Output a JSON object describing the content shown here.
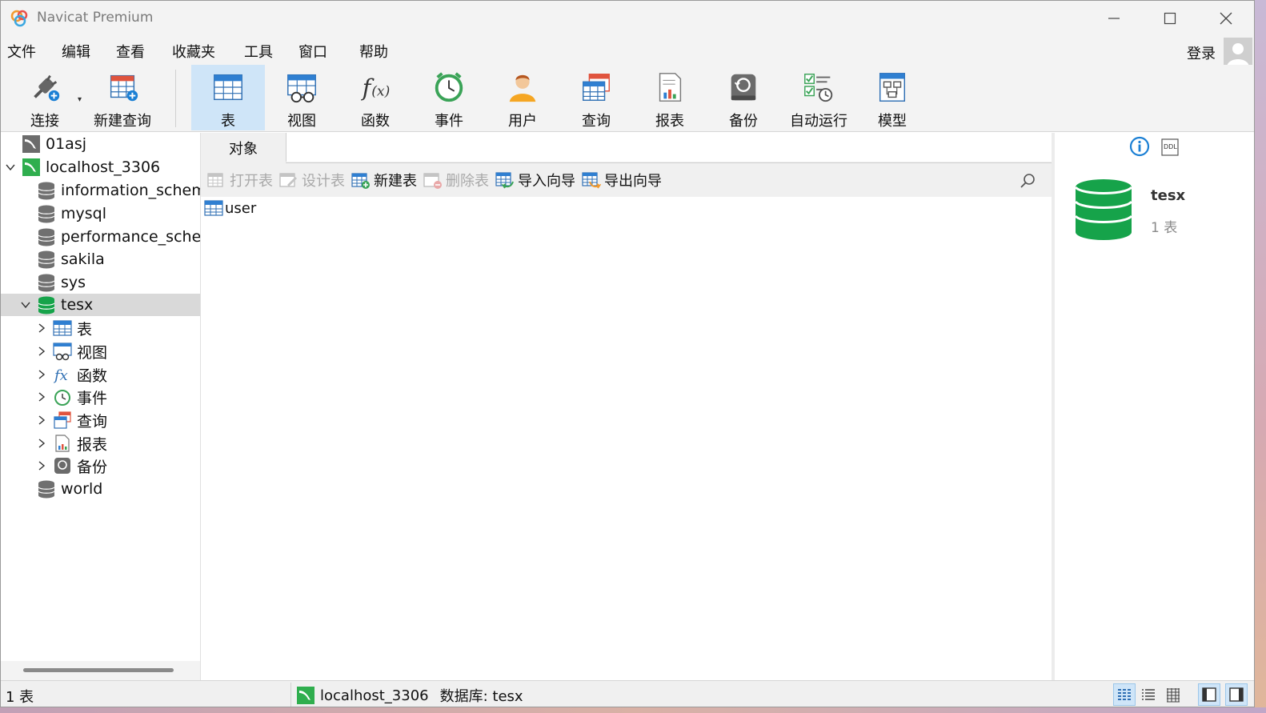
{
  "app": {
    "title": "Navicat Premium",
    "colors": {
      "accent": "#1a7fd4",
      "selection": "#cfe5f8",
      "db_green": "#16a34a"
    }
  },
  "menu": [
    "文件",
    "编辑",
    "查看",
    "收藏夹",
    "工具",
    "窗口",
    "帮助"
  ],
  "login_label": "登录",
  "toolbar": {
    "connect": "连接",
    "new_query": "新建查询",
    "items": [
      {
        "label": "表",
        "icon": "table-icon",
        "active": true
      },
      {
        "label": "视图",
        "icon": "view-icon"
      },
      {
        "label": "函数",
        "icon": "function-icon"
      },
      {
        "label": "事件",
        "icon": "event-clock-icon"
      },
      {
        "label": "用户",
        "icon": "user-icon"
      },
      {
        "label": "查询",
        "icon": "query-icon"
      },
      {
        "label": "报表",
        "icon": "report-icon"
      },
      {
        "label": "备份",
        "icon": "backup-icon"
      },
      {
        "label": "自动运行",
        "icon": "automation-icon"
      },
      {
        "label": "模型",
        "icon": "model-icon"
      }
    ]
  },
  "tree": {
    "connections": [
      {
        "name": "01asj"
      },
      {
        "name": "localhost_3306"
      }
    ],
    "databases": [
      "information_schema",
      "mysql",
      "performance_schema",
      "sakila",
      "sys",
      "tesx",
      "world"
    ],
    "selected_db": "tesx",
    "categories": [
      "表",
      "视图",
      "函数",
      "事件",
      "查询",
      "报表",
      "备份"
    ]
  },
  "objects": {
    "tab_label": "对象",
    "actions": {
      "open_table": "打开表",
      "design_table": "设计表",
      "new_table": "新建表",
      "delete_table": "删除表",
      "import_wizard": "导入向导",
      "export_wizard": "导出向导"
    },
    "items": [
      "user"
    ]
  },
  "info": {
    "db_name": "tesx",
    "count": "1 表",
    "ddl_label": "DDL"
  },
  "status": {
    "left": "1 表",
    "connection": "localhost_3306",
    "database": "数据库: tesx"
  }
}
